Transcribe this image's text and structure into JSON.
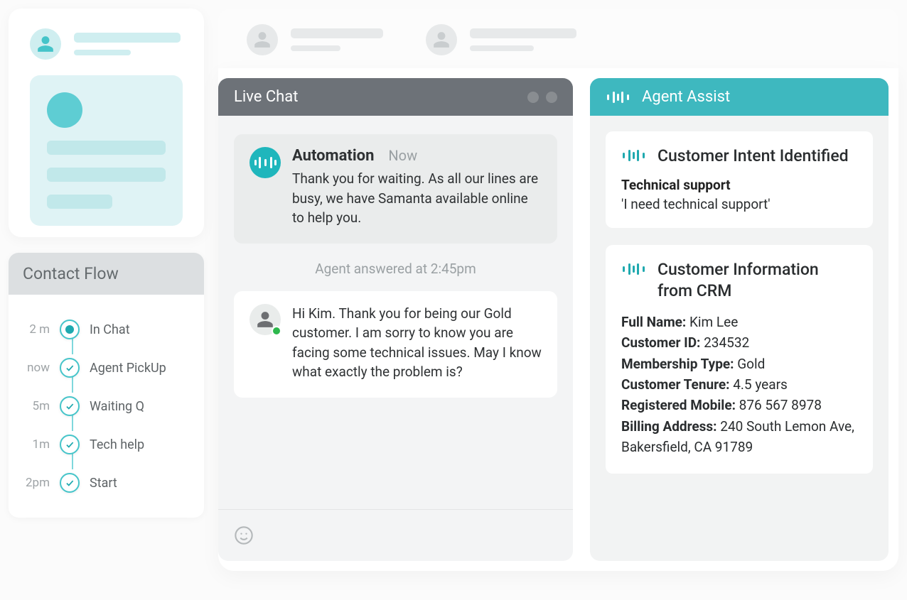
{
  "left": {
    "contact_flow_title": "Contact Flow",
    "flow": [
      {
        "time": "2 m",
        "label": "In Chat",
        "current": true
      },
      {
        "time": "now",
        "label": "Agent PickUp",
        "current": false
      },
      {
        "time": "5m",
        "label": "Waiting Q",
        "current": false
      },
      {
        "time": "1m",
        "label": "Tech help",
        "current": false
      },
      {
        "time": "2pm",
        "label": "Start",
        "current": false
      }
    ]
  },
  "chat": {
    "title": "Live Chat",
    "messages": [
      {
        "sender": "Automation",
        "time": "Now",
        "text": "Thank you for waiting. As all our lines are busy, we have Samanta available online to help you.",
        "type": "bot"
      }
    ],
    "system_line": "Agent answered at 2:45pm",
    "agent_message": {
      "text": "Hi Kim. Thank you for being our Gold customer. I am sorry to know you are facing some technical issues. May I know what exactly the problem is?"
    }
  },
  "assist": {
    "title": "Agent Assist",
    "intent_card_title": "Customer Intent Identified",
    "intent_tag": "Technical support",
    "intent_quote": "'I need technical support'",
    "crm_card_title": "Customer Information from CRM",
    "crm": {
      "full_name_label": "Full Name:",
      "full_name": "Kim Lee",
      "customer_id_label": "Customer ID:",
      "customer_id": "234532",
      "membership_type_label": "Membership Type:",
      "membership_type": "Gold",
      "tenure_label": "Customer Tenure:",
      "tenure": "4.5 years",
      "mobile_label": "Registered Mobile:",
      "mobile": "876 567 8978",
      "address_label": "Billing Address:",
      "address": "240 South Lemon Ave, Bakersfield, CA 91789"
    }
  }
}
